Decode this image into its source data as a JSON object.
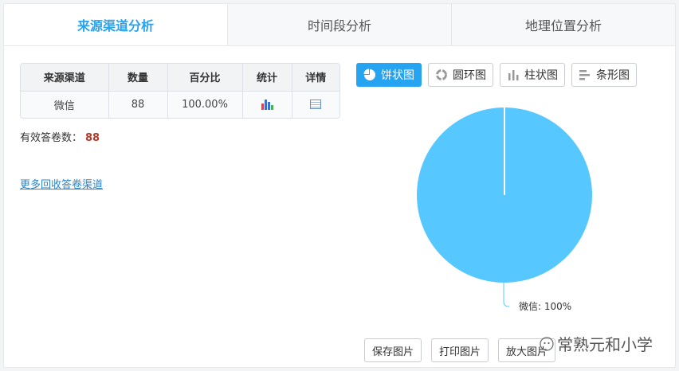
{
  "tabs": [
    {
      "label": "来源渠道分析",
      "active": true
    },
    {
      "label": "时间段分析",
      "active": false
    },
    {
      "label": "地理位置分析",
      "active": false
    }
  ],
  "table": {
    "headers": [
      "来源渠道",
      "数量",
      "百分比",
      "统计",
      "详情"
    ],
    "rows": [
      {
        "channel": "微信",
        "count": "88",
        "percent": "100.00%"
      }
    ]
  },
  "valid_label": "有效答卷数：",
  "valid_count": "88",
  "more_link": "更多回收答卷渠道",
  "chart_types": [
    {
      "label": "饼状图",
      "icon": "pie-chart-icon",
      "active": true
    },
    {
      "label": "圆环图",
      "icon": "donut-chart-icon",
      "active": false
    },
    {
      "label": "柱状图",
      "icon": "column-chart-icon",
      "active": false
    },
    {
      "label": "条形图",
      "icon": "bar-chart-icon",
      "active": false
    }
  ],
  "chart_data": {
    "type": "pie",
    "slices": [
      {
        "label": "微信",
        "value": 100
      }
    ],
    "slice_label": "微信: 100%",
    "color": "#57c8ff"
  },
  "actions": {
    "save": "保存图片",
    "print": "打印图片",
    "zoom": "放大图片"
  },
  "watermark": "常熟元和小学",
  "colors": {
    "accent": "#26a3f1",
    "pie": "#57c8ff",
    "count": "#b33a2a"
  }
}
